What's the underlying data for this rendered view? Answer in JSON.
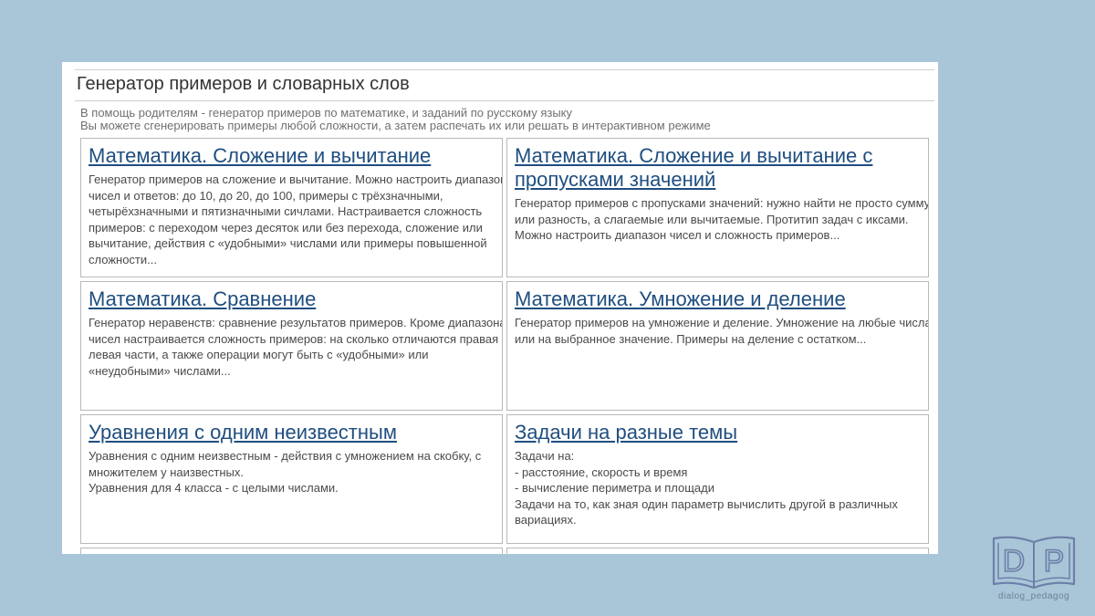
{
  "page": {
    "title": "Генератор примеров и словарных слов",
    "intro": [
      "В помощь родителям - генератор примеров по математике, и заданий по русскому языку",
      "Вы можете сгенерировать примеры любой сложности, а затем распечать их или решать в интерактивном режиме"
    ]
  },
  "cards": [
    {
      "title_lines": [
        "Математика. Сложение и вычитание"
      ],
      "desc_lines": [
        "Генератор примеров на сложение и вычитание. Можно настроить диапазон",
        "чисел и ответов: до 10, до 20, до 100, примеры с трёхзначными,",
        "четырёхзначными и пятизначными сичлами. Настраивается сложность",
        "примеров: с переходом через десяток или без перехода, сложение или",
        "вычитание, действия с «удобными» числами или примеры повышенной",
        "сложности..."
      ]
    },
    {
      "title_lines": [
        "Математика. Сложение и вычитание с",
        "пропусками значений"
      ],
      "desc_lines": [
        "Генератор примеров с пропусками значений: нужно найти не просто сумму",
        "или разность, а слагаемые или вычитаемые. Протитип задач с иксами.",
        "Можно настроить диапазон чисел и сложность примеров..."
      ]
    },
    {
      "title_lines": [
        "Математика. Сравнение"
      ],
      "desc_lines": [
        "Генератор неравенств: сравнение результатов примеров. Кроме диапазона",
        "чисел настраивается сложность примеров: на сколько отличаются правая и",
        "левая части, а также операции могут быть с «удобными» или",
        "«неудобными» числами..."
      ]
    },
    {
      "title_lines": [
        "Математика. Умножение и деление"
      ],
      "desc_lines": [
        "Генератор примеров на умножение и деление. Умножение на любые числа",
        "или на выбранное значение. Примеры на деление с остатком..."
      ]
    },
    {
      "title_lines": [
        "Уравнения с одним неизвестным"
      ],
      "desc_lines": [
        "Уравнения с одним неизвестным - действия с умножением на скобку, с",
        "множителем у наизвестных.",
        "Уравнения для 4 класса - с целыми числами."
      ]
    },
    {
      "title_lines": [
        "Задачи на разные темы"
      ],
      "desc_lines": [
        "Задачи на:",
        "- расстояние, скорость и время",
        "- вычисление периметра и площади",
        "Задачи на то, как зная один параметр вычислить другой в различных",
        "вариациях."
      ]
    }
  ],
  "logo": {
    "letters": [
      "D",
      "P"
    ],
    "caption": "dialog_pedagog"
  }
}
